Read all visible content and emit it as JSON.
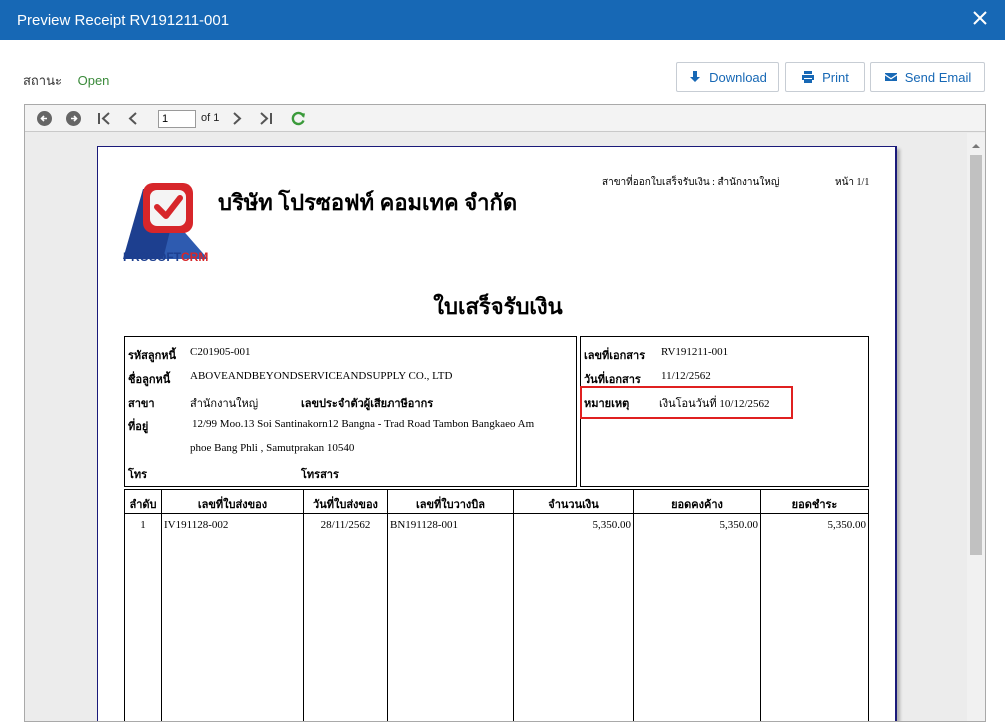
{
  "window": {
    "title": "Preview Receipt RV191211-001"
  },
  "status": {
    "label": "สถานะ",
    "value": "Open"
  },
  "actions": {
    "download": "Download",
    "print": "Print",
    "send_email": "Send Email"
  },
  "viewer": {
    "page_value": "1",
    "page_of": "of 1"
  },
  "receipt": {
    "logo_text_main": "PROSOFT",
    "logo_text_accent": "CRM",
    "company_name": "บริษัท โปรซอฟท์ คอมเทค จำกัด",
    "branch_header": "สาขาที่ออกใบเสร็จรับเงิน : สำนักงานใหญ่",
    "page_no": "หน้า 1/1",
    "title": "ใบเสร็จรับเงิน",
    "customer": {
      "code_label": "รหัสลูกหนี้",
      "code": "C201905-001",
      "name_label": "ชื่อลูกหนี้",
      "name": "ABOVEANDBEYONDSERVICEANDSUPPLY CO., LTD",
      "branch_label": "สาขา",
      "branch": "สำนักงานใหญ่",
      "tax_label": "เลขประจำตัวผู้เสียภาษีอากร",
      "address_label": "ที่อยู่",
      "address_line1": "12/99 Moo.13 Soi Santinakorn12 Bangna - Trad Road Tambon Bangkaeo Am",
      "address_line2": "phoe Bang Phli , Samutprakan  10540",
      "phone_label": "โทร",
      "fax_label": "โทรสาร"
    },
    "document": {
      "no_label": "เลขที่เอกสาร",
      "no": "RV191211-001",
      "date_label": "วันที่เอกสาร",
      "date": "11/12/2562",
      "remark_label": "หมายเหตุ",
      "remark": "เงินโอนวันที่ 10/12/2562"
    },
    "table": {
      "headers": [
        "ลำดับ",
        "เลขที่ใบส่งของ",
        "วันที่ใบส่งของ",
        "เลขที่ใบวางบิล",
        "จำนวนเงิน",
        "ยอดคงค้าง",
        "ยอดชำระ"
      ],
      "rows": [
        [
          "1",
          "IV191128-002",
          "28/11/2562",
          "BN191128-001",
          "5,350.00",
          "5,350.00",
          "5,350.00"
        ]
      ]
    }
  },
  "colors": {
    "titlebar": "#1768b5",
    "status_open": "#3a8a3a",
    "highlight": "#e02020",
    "logo_blue": "#1d3f8f",
    "logo_red": "#d7262a"
  }
}
